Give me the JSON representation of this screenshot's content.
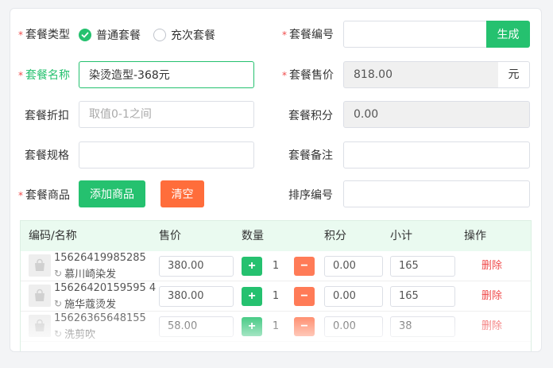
{
  "form": {
    "package_type": {
      "label": "套餐类型",
      "options": [
        "普通套餐",
        "充次套餐"
      ],
      "selected": 0
    },
    "package_code": {
      "label": "套餐编号",
      "value": "",
      "generate_label": "生成"
    },
    "package_name": {
      "label": "套餐名称",
      "value": "染烫造型-368元"
    },
    "package_price": {
      "label": "套餐售价",
      "value": "818.00",
      "unit": "元"
    },
    "package_discount": {
      "label": "套餐折扣",
      "placeholder": "取值0-1之间"
    },
    "package_points": {
      "label": "套餐积分",
      "value": "0.00"
    },
    "package_spec": {
      "label": "套餐规格",
      "value": ""
    },
    "package_remark": {
      "label": "套餐备注",
      "value": ""
    },
    "package_goods": {
      "label": "套餐商品",
      "add_label": "添加商品",
      "clear_label": "清空"
    },
    "sort_number": {
      "label": "排序编号",
      "value": ""
    }
  },
  "table": {
    "columns": [
      "编码/名称",
      "售价",
      "数量",
      "积分",
      "小计",
      "操作"
    ],
    "rows": [
      {
        "code": "15626419985285",
        "name": "慕川崎染发",
        "price": "380.00",
        "qty": "1",
        "points": "0.00",
        "subtotal": "165",
        "action": "删除"
      },
      {
        "code": "15626420159595 4",
        "name": "施华蔻烫发",
        "price": "380.00",
        "qty": "1",
        "points": "0.00",
        "subtotal": "165",
        "action": "删除"
      },
      {
        "code": "15626365648155",
        "name": "洗剪吹",
        "price": "58.00",
        "qty": "1",
        "points": "0.00",
        "subtotal": "38",
        "action": "删除"
      }
    ]
  },
  "colors": {
    "accent": "#25c16f",
    "danger": "#f04c4c",
    "orange": "#ff6d3b"
  }
}
